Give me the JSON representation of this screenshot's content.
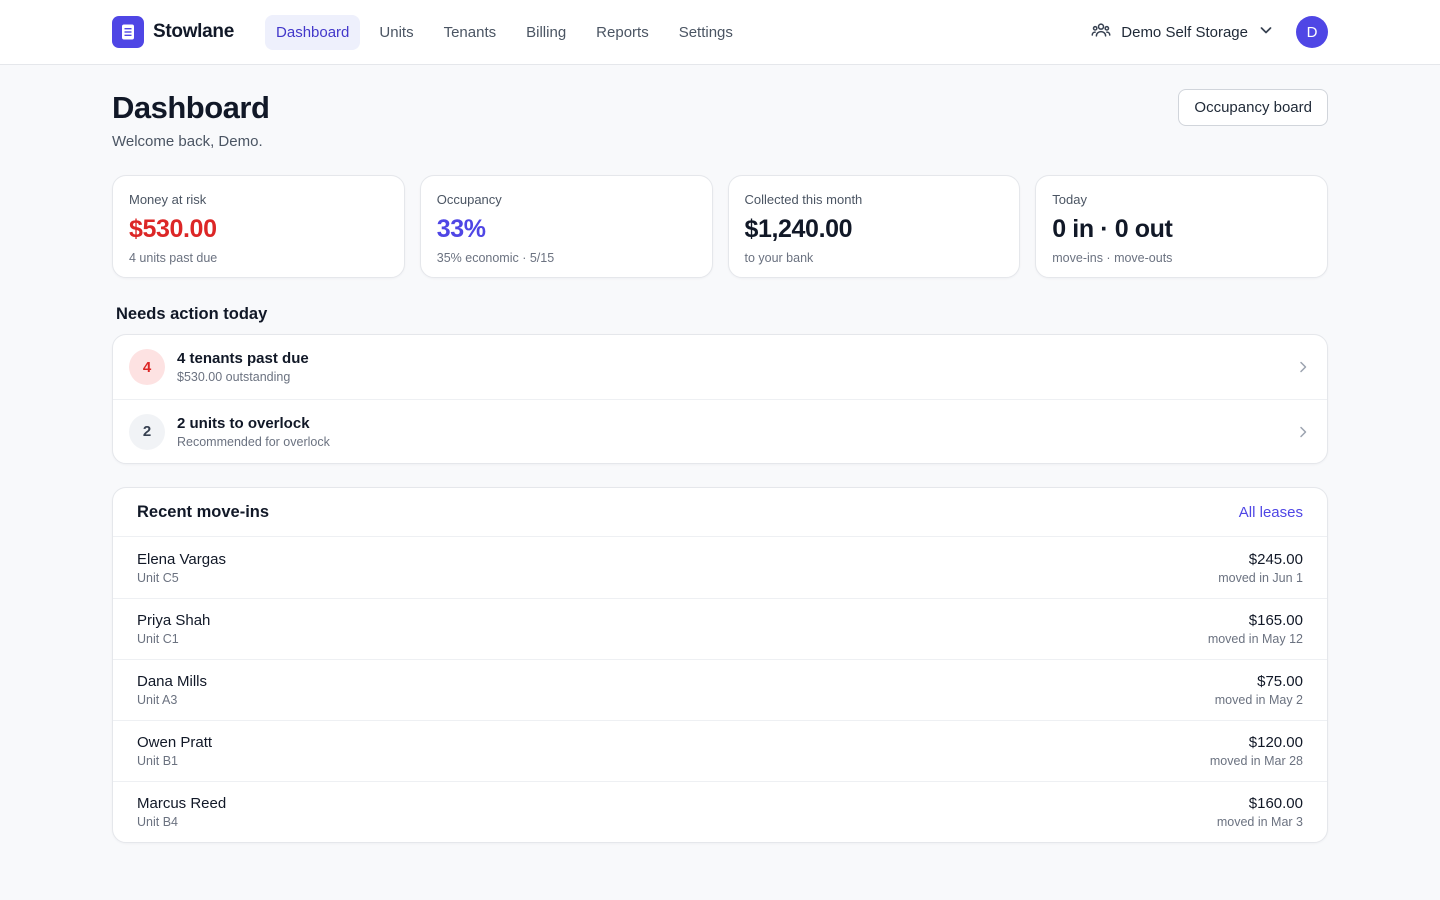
{
  "app": {
    "brand_name": "Stowlane",
    "brand_color": "#4f46e5"
  },
  "nav": {
    "items": [
      {
        "label": "Dashboard",
        "active": true
      },
      {
        "label": "Units",
        "active": false
      },
      {
        "label": "Tenants",
        "active": false
      },
      {
        "label": "Billing",
        "active": false
      },
      {
        "label": "Reports",
        "active": false
      },
      {
        "label": "Settings",
        "active": false
      }
    ]
  },
  "facility": {
    "name": "Demo Self Storage",
    "icon": "users-icon"
  },
  "user": {
    "avatar_initial": "D"
  },
  "page": {
    "title": "Dashboard",
    "subtitle": "Welcome back, Demo.",
    "occupancy_board_label": "Occupancy board"
  },
  "stats": [
    {
      "label": "Money at risk",
      "value": "$530.00",
      "sub": "4 units past due",
      "color": "#dc2626"
    },
    {
      "label": "Occupancy",
      "value": "33%",
      "sub": "35% economic · 5/15",
      "color": "#4f46e5"
    },
    {
      "label": "Collected this month",
      "value": "$1,240.00",
      "sub": "to your bank",
      "color": "#111827"
    },
    {
      "label": "Today",
      "value": "0 in · 0 out",
      "sub": "move-ins · move-outs",
      "color": "#111827"
    }
  ],
  "needs_action": {
    "title": "Needs action today",
    "items": [
      {
        "count": "4",
        "title": "4 tenants past due",
        "sub": "$530.00 outstanding",
        "tone": "danger"
      },
      {
        "count": "2",
        "title": "2 units to overlock",
        "sub": "Recommended for overlock",
        "tone": "neutral"
      }
    ]
  },
  "recent_moveins": {
    "title": "Recent move-ins",
    "link_label": "All leases",
    "rows": [
      {
        "name": "Elena Vargas",
        "unit": "Unit C5",
        "amount": "$245.00",
        "date": "moved in Jun 1"
      },
      {
        "name": "Priya Shah",
        "unit": "Unit C1",
        "amount": "$165.00",
        "date": "moved in May 12"
      },
      {
        "name": "Dana Mills",
        "unit": "Unit A3",
        "amount": "$75.00",
        "date": "moved in May 2"
      },
      {
        "name": "Owen Pratt",
        "unit": "Unit B1",
        "amount": "$120.00",
        "date": "moved in Mar 28"
      },
      {
        "name": "Marcus Reed",
        "unit": "Unit B4",
        "amount": "$160.00",
        "date": "moved in Mar 3"
      }
    ]
  }
}
